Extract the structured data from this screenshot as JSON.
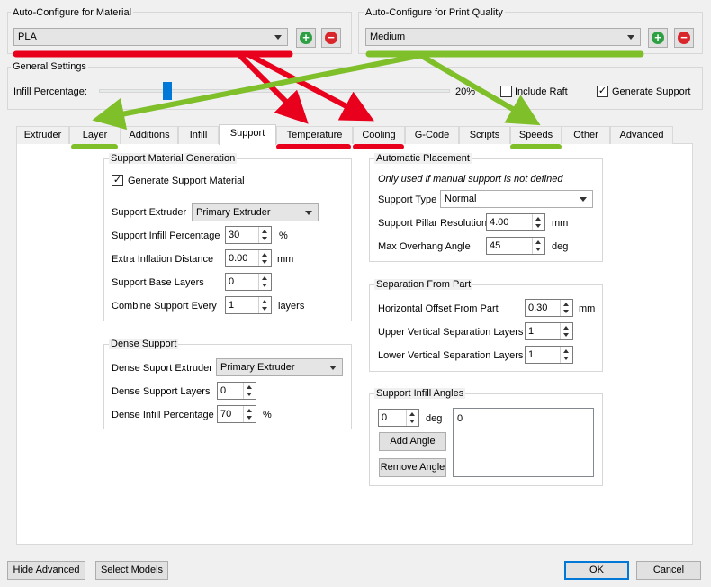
{
  "material": {
    "title": "Auto-Configure for Material",
    "selected": "PLA",
    "add_icon": "plus-circle-icon",
    "remove_icon": "minus-circle-icon"
  },
  "quality": {
    "title": "Auto-Configure for Print Quality",
    "selected": "Medium"
  },
  "general": {
    "title": "General Settings",
    "infill_label": "Infill Percentage:",
    "infill_value": "20%",
    "infill_fraction": 0.2,
    "include_raft": {
      "label": "Include Raft",
      "checked": false
    },
    "generate_support": {
      "label": "Generate Support",
      "checked": true
    }
  },
  "tabs": [
    {
      "label": "Extruder"
    },
    {
      "label": "Layer"
    },
    {
      "label": "Additions"
    },
    {
      "label": "Infill"
    },
    {
      "label": "Support",
      "active": true
    },
    {
      "label": "Temperature"
    },
    {
      "label": "Cooling"
    },
    {
      "label": "G-Code"
    },
    {
      "label": "Scripts"
    },
    {
      "label": "Speeds"
    },
    {
      "label": "Other"
    },
    {
      "label": "Advanced"
    }
  ],
  "support_generation": {
    "title": "Support Material Generation",
    "generate_label": "Generate Support Material",
    "generate_checked": true,
    "extruder_label": "Support Extruder",
    "extruder_value": "Primary Extruder",
    "infill_label": "Support Infill Percentage",
    "infill_value": "30",
    "infill_unit": "%",
    "inflation_label": "Extra Inflation Distance",
    "inflation_value": "0.00",
    "inflation_unit": "mm",
    "base_layers_label": "Support Base Layers",
    "base_layers_value": "0",
    "combine_label": "Combine Support Every",
    "combine_value": "1",
    "combine_unit": "layers"
  },
  "dense_support": {
    "title": "Dense Support",
    "extruder_label": "Dense Suport Extruder",
    "extruder_value": "Primary Extruder",
    "layers_label": "Dense Support Layers",
    "layers_value": "0",
    "infill_label": "Dense Infill Percentage",
    "infill_value": "70",
    "infill_unit": "%"
  },
  "auto_placement": {
    "title": "Automatic Placement",
    "note": "Only used if manual support is not defined",
    "type_label": "Support Type",
    "type_value": "Normal",
    "pillar_label": "Support Pillar Resolution",
    "pillar_value": "4.00",
    "pillar_unit": "mm",
    "overhang_label": "Max Overhang Angle",
    "overhang_value": "45",
    "overhang_unit": "deg"
  },
  "separation": {
    "title": "Separation From Part",
    "horizontal_label": "Horizontal Offset From Part",
    "horizontal_value": "0.30",
    "horizontal_unit": "mm",
    "upper_label": "Upper Vertical Separation Layers",
    "upper_value": "1",
    "lower_label": "Lower Vertical Separation Layers",
    "lower_value": "1"
  },
  "infill_angles": {
    "title": "Support Infill Angles",
    "angle_value": "0",
    "angle_unit": "deg",
    "add_label": "Add Angle",
    "remove_label": "Remove Angle",
    "list": [
      "0"
    ]
  },
  "footer": {
    "hide_advanced": "Hide Advanced",
    "select_models": "Select Models",
    "ok": "OK",
    "cancel": "Cancel"
  },
  "annotation_colors": {
    "red": "#e8001c",
    "green": "#7fbf2a"
  }
}
